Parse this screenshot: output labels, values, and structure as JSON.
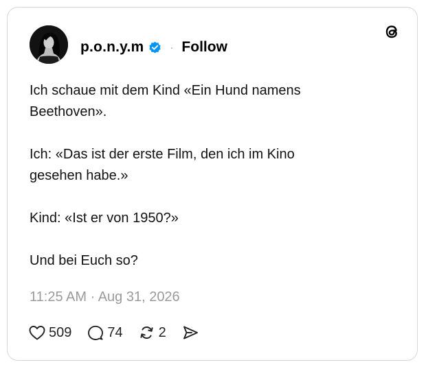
{
  "post": {
    "author": {
      "username": "p.o.n.y.m",
      "verified": true,
      "avatar_icon": "avatar-photo",
      "follow_label": "Follow",
      "separator": "·"
    },
    "app_icon": "threads-logo-icon",
    "paragraphs": [
      {
        "line1": "Ich schaue mit dem Kind «Ein Hund namens",
        "line2": "Beethoven»."
      },
      {
        "line1": "Ich: «Das ist der erste Film, den ich im Kino",
        "line2": "gesehen habe.»"
      },
      {
        "line1": "Kind: «Ist er von 1950?»",
        "line2": ""
      },
      {
        "line1": "Und bei Euch so?",
        "line2": ""
      }
    ],
    "timestamp": "11:25 AM · Aug 31, 2026",
    "actions": {
      "likes": "509",
      "replies": "74",
      "reposts": "2"
    },
    "colors": {
      "verified_blue": "#0095f6",
      "muted_text": "#9a9a9a",
      "border": "#d6d6d6"
    }
  }
}
